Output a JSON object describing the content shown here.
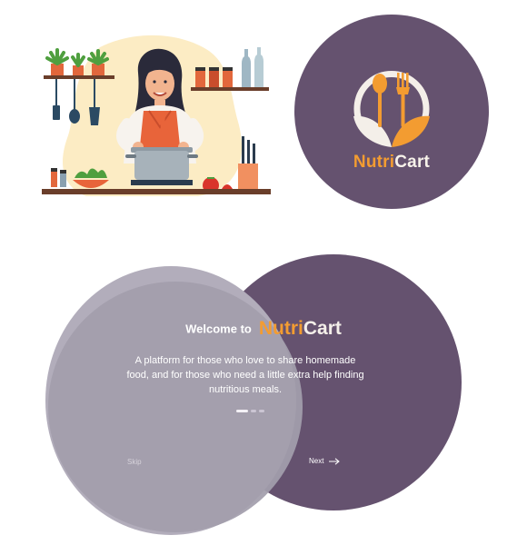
{
  "logo": {
    "part1": "Nutri",
    "part2": "Cart"
  },
  "onboarding": {
    "welcome_prefix": "Welcome to",
    "brand_part1": "Nutri",
    "brand_part2": "Cart",
    "description": "A platform for those who love to share homemade food, and for those who need a little extra help finding nutritious meals.",
    "page_indicator": {
      "current": 1,
      "total": 3
    },
    "skip_label": "Skip",
    "next_label": "Next"
  },
  "icons": {
    "logo": "spoon-fork-leaf-icon",
    "next": "arrow-right-icon"
  },
  "colors": {
    "primary_purple": "#65526f",
    "accent_orange": "#f39c31",
    "overlay_grey": "#a39eac",
    "illustration_cream": "#fcecc4"
  }
}
